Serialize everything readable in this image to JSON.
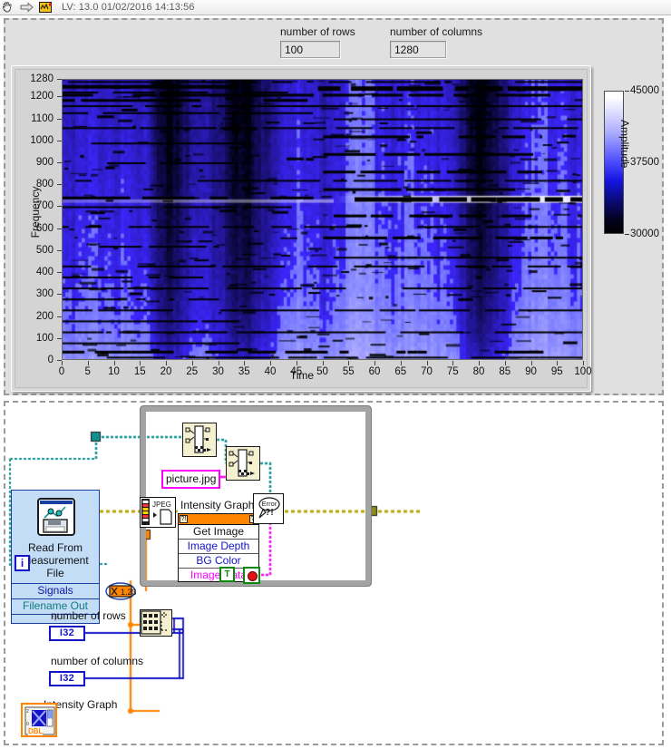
{
  "titlebar": {
    "text": "LV: 13.0 01/02/2016 14:13:56",
    "icons": [
      "hand-cursor-icon",
      "arrow-right-icon",
      "labview-icon"
    ]
  },
  "front_panel": {
    "controls": [
      {
        "name": "number-of-rows",
        "label": "number of rows",
        "value": "100"
      },
      {
        "name": "number-of-columns",
        "label": "number of columns",
        "value": "1280"
      }
    ],
    "graph": {
      "name": "intensity-graph",
      "colorbar_label": "Amplitude"
    }
  },
  "chart_data": {
    "type": "heatmap",
    "title": "",
    "xlabel": "Time",
    "ylabel": "Frequency",
    "xlim": [
      0,
      100
    ],
    "ylim": [
      0,
      1280
    ],
    "xticks": [
      0,
      5,
      10,
      15,
      20,
      25,
      30,
      35,
      40,
      45,
      50,
      55,
      60,
      65,
      70,
      75,
      80,
      85,
      90,
      95,
      100
    ],
    "yticks": [
      0,
      100,
      200,
      300,
      400,
      500,
      600,
      700,
      800,
      900,
      1000,
      1100,
      1200,
      1280
    ],
    "grid": false,
    "colorbar": {
      "label": "Amplitude",
      "ticks": [
        30000,
        37500,
        45000
      ],
      "min": 30000,
      "max": 45000,
      "colors": [
        "#000000",
        "#0000ff",
        "#ffffff"
      ]
    },
    "description": "Spectrogram-style intensity map: blue background gradient with vertical darker bands near Time=20-30, 35-45 and 78-88, plus many horizontal black harmonic streaks. A bright whitish horizontal ridge runs near Frequency 700-760 from Time~50 to 100.",
    "column_band_intensity": [
      0.62,
      0.6,
      0.59,
      0.58,
      0.57,
      0.56,
      0.56,
      0.57,
      0.58,
      0.58,
      0.57,
      0.56,
      0.55,
      0.55,
      0.56,
      0.58,
      0.62,
      0.7,
      0.8,
      0.88,
      0.92,
      0.9,
      0.84,
      0.78,
      0.72,
      0.68,
      0.66,
      0.66,
      0.68,
      0.72,
      0.76,
      0.8,
      0.86,
      0.92,
      0.95,
      0.93,
      0.88,
      0.8,
      0.74,
      0.7,
      0.66,
      0.62,
      0.58,
      0.55,
      0.53,
      0.52,
      0.52,
      0.53,
      0.55,
      0.58,
      0.62,
      0.6,
      0.56,
      0.52,
      0.48,
      0.45,
      0.44,
      0.45,
      0.47,
      0.5,
      0.52,
      0.53,
      0.54,
      0.54,
      0.53,
      0.52,
      0.51,
      0.5,
      0.5,
      0.51,
      0.52,
      0.54,
      0.56,
      0.59,
      0.63,
      0.68,
      0.74,
      0.82,
      0.9,
      0.94,
      0.92,
      0.86,
      0.8,
      0.74,
      0.68,
      0.62,
      0.57,
      0.53,
      0.5,
      0.48,
      0.47,
      0.47,
      0.48,
      0.49,
      0.5,
      0.51,
      0.52,
      0.53,
      0.54,
      0.55
    ],
    "row_streaks": [
      {
        "freq": 1270,
        "t0": 0,
        "t1": 100,
        "w": 2
      },
      {
        "freq": 1248,
        "t0": 0,
        "t1": 46,
        "w": 4
      },
      {
        "freq": 1240,
        "t0": 49,
        "t1": 100,
        "w": 5
      },
      {
        "freq": 1222,
        "t0": 0,
        "t1": 44,
        "w": 2
      },
      {
        "freq": 1210,
        "t0": 0,
        "t1": 100,
        "w": 3
      },
      {
        "freq": 1186,
        "t0": 0,
        "t1": 47,
        "w": 3
      },
      {
        "freq": 1160,
        "t0": 0,
        "t1": 100,
        "w": 2
      },
      {
        "freq": 1128,
        "t0": 0,
        "t1": 48,
        "w": 2
      },
      {
        "freq": 1100,
        "t0": 52,
        "t1": 100,
        "w": 2
      },
      {
        "freq": 1060,
        "t0": 0,
        "t1": 100,
        "w": 2
      },
      {
        "freq": 1020,
        "t0": 50,
        "t1": 92,
        "w": 3
      },
      {
        "freq": 990,
        "t0": 0,
        "t1": 36,
        "w": 2
      },
      {
        "freq": 940,
        "t0": 50,
        "t1": 95,
        "w": 3
      },
      {
        "freq": 900,
        "t0": 0,
        "t1": 34,
        "w": 2
      },
      {
        "freq": 860,
        "t0": 50,
        "t1": 92,
        "w": 3
      },
      {
        "freq": 820,
        "t0": 0,
        "t1": 100,
        "w": 2
      },
      {
        "freq": 780,
        "t0": 50,
        "t1": 95,
        "w": 3
      },
      {
        "freq": 742,
        "t0": 0,
        "t1": 50,
        "w": 3
      },
      {
        "freq": 735,
        "t0": 56,
        "t1": 100,
        "w": 5
      },
      {
        "freq": 700,
        "t0": 0,
        "t1": 44,
        "w": 2
      },
      {
        "freq": 660,
        "t0": 52,
        "t1": 90,
        "w": 3
      },
      {
        "freq": 610,
        "t0": 0,
        "t1": 100,
        "w": 2
      },
      {
        "freq": 560,
        "t0": 50,
        "t1": 96,
        "w": 3
      },
      {
        "freq": 520,
        "t0": 0,
        "t1": 30,
        "w": 2
      },
      {
        "freq": 470,
        "t0": 52,
        "t1": 100,
        "w": 2
      },
      {
        "freq": 430,
        "t0": 0,
        "t1": 100,
        "w": 2
      },
      {
        "freq": 380,
        "t0": 0,
        "t1": 28,
        "w": 2
      },
      {
        "freq": 330,
        "t0": 0,
        "t1": 100,
        "w": 2
      },
      {
        "freq": 280,
        "t0": 0,
        "t1": 30,
        "w": 2
      },
      {
        "freq": 230,
        "t0": 0,
        "t1": 100,
        "w": 2
      },
      {
        "freq": 180,
        "t0": 0,
        "t1": 36,
        "w": 2
      },
      {
        "freq": 130,
        "t0": 0,
        "t1": 100,
        "w": 2
      },
      {
        "freq": 80,
        "t0": 0,
        "t1": 34,
        "w": 2
      },
      {
        "freq": 40,
        "t0": 0,
        "t1": 100,
        "w": 3
      },
      {
        "freq": 15,
        "t0": 0,
        "t1": 100,
        "w": 2
      }
    ],
    "bright_ridge": {
      "freq_start": 720,
      "freq_end": 752,
      "t0": 52,
      "t1": 100
    }
  },
  "block_diagram": {
    "read_vi": {
      "name": "read-from-measurement-file",
      "title_lines": [
        "Read From",
        "Measurement",
        "File"
      ],
      "outputs": [
        "Signals",
        "Filename Out"
      ]
    },
    "string_constant": {
      "name": "picture-jpg-constant",
      "value": "picture.jpg"
    },
    "property_node": {
      "name": "intensity-graph-property-node",
      "title": "Intensity Graph",
      "rows": [
        {
          "label": "Get Image",
          "color": "#111111"
        },
        {
          "label": "Image Depth",
          "color": "#1414c8"
        },
        {
          "label": "BG Color",
          "color": "#1414c8"
        },
        {
          "label": "Image Data",
          "color": "#ff00ff"
        }
      ]
    },
    "indicators": [
      {
        "name": "number-of-rows-terminal",
        "label": "number of rows",
        "type": "I32"
      },
      {
        "name": "number-of-columns-terminal",
        "label": "number of columns",
        "type": "I32"
      }
    ],
    "graph_terminal": {
      "name": "intensity-graph-terminal",
      "label": "Intensity Graph",
      "type": "DBL"
    },
    "loop": {
      "name": "while-loop",
      "iteration_label": "i",
      "stop_label": "T"
    },
    "nodes": [
      {
        "name": "build-path-node-1"
      },
      {
        "name": "build-path-node-2"
      },
      {
        "name": "write-jpeg-file-node",
        "label": "JPEG"
      },
      {
        "name": "simple-error-handler-node",
        "label": "Error ?!"
      },
      {
        "name": "array-size-node"
      }
    ]
  }
}
